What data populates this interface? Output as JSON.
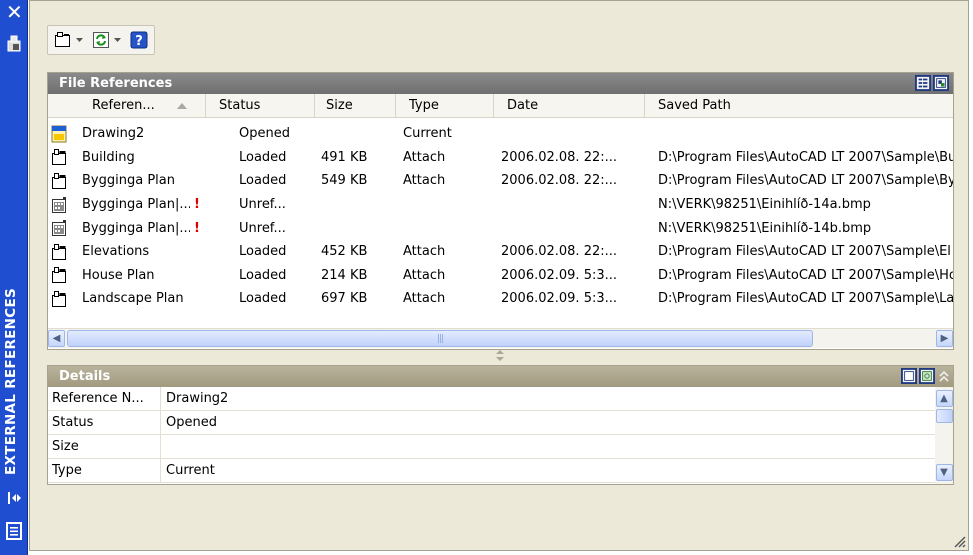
{
  "palette": {
    "title": "EXTERNAL REFERENCES"
  },
  "toolbar": {
    "attach_icon": "attach-dwg-icon",
    "refresh_icon": "refresh-icon",
    "help_icon": "help-icon"
  },
  "file_references": {
    "title": "File References",
    "columns": [
      "Referen...",
      "Status",
      "Size",
      "Type",
      "Date",
      "Saved Path"
    ],
    "rows": [
      {
        "icon": "drawing-icon",
        "name": "Drawing2",
        "warn": "",
        "status": "Opened",
        "size": "",
        "type": "Current",
        "date": "",
        "path": ""
      },
      {
        "icon": "dwg-icon",
        "name": "Building",
        "warn": "",
        "status": "Loaded",
        "size": "491 KB",
        "type": "Attach",
        "date": "2006.02.08. 22:...",
        "path": "D:\\Program Files\\AutoCAD LT 2007\\Sample\\Bu"
      },
      {
        "icon": "dwg-icon",
        "name": "Bygginga Plan",
        "warn": "",
        "status": "Loaded",
        "size": "549 KB",
        "type": "Attach",
        "date": "2006.02.08. 22:...",
        "path": "D:\\Program Files\\AutoCAD LT 2007\\Sample\\By"
      },
      {
        "icon": "image-icon",
        "name": "Bygginga Plan|...",
        "warn": "!",
        "status": "Unref...",
        "size": "",
        "type": "",
        "date": "",
        "path": "N:\\VERK\\98251\\Einihlíð-14a.bmp"
      },
      {
        "icon": "image-icon",
        "name": "Bygginga Plan|...",
        "warn": "!",
        "status": "Unref...",
        "size": "",
        "type": "",
        "date": "",
        "path": "N:\\VERK\\98251\\Einihlíð-14b.bmp"
      },
      {
        "icon": "dwg-icon",
        "name": "Elevations",
        "warn": "",
        "status": "Loaded",
        "size": "452 KB",
        "type": "Attach",
        "date": "2006.02.08. 22:...",
        "path": "D:\\Program Files\\AutoCAD LT 2007\\Sample\\El"
      },
      {
        "icon": "dwg-icon",
        "name": "House Plan",
        "warn": "",
        "status": "Loaded",
        "size": "214 KB",
        "type": "Attach",
        "date": "2006.02.09. 5:3...",
        "path": "D:\\Program Files\\AutoCAD LT 2007\\Sample\\Ho"
      },
      {
        "icon": "dwg-icon",
        "name": "Landscape Plan",
        "warn": "",
        "status": "Loaded",
        "size": "697 KB",
        "type": "Attach",
        "date": "2006.02.09. 5:3...",
        "path": "D:\\Program Files\\AutoCAD LT 2007\\Sample\\La"
      }
    ]
  },
  "details": {
    "title": "Details",
    "rows": [
      {
        "label": "Reference N...",
        "value": "Drawing2"
      },
      {
        "label": "Status",
        "value": "Opened"
      },
      {
        "label": "Size",
        "value": ""
      },
      {
        "label": "Type",
        "value": "Current"
      }
    ]
  },
  "colors": {
    "title_strip": "#1f4fd0",
    "header_gray": "#777777",
    "header_tan": "#aca58b",
    "warning": "#e00000"
  }
}
